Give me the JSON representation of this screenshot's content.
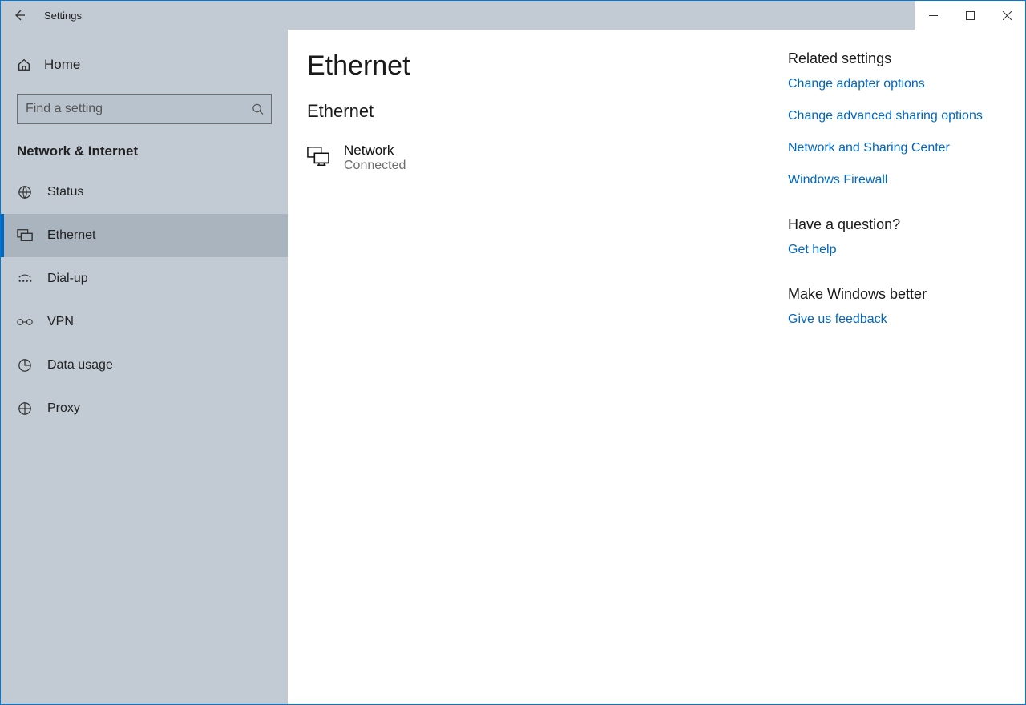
{
  "window": {
    "title": "Settings"
  },
  "sidebar": {
    "home": "Home",
    "search_placeholder": "Find a setting",
    "section": "Network & Internet",
    "items": [
      {
        "label": "Status"
      },
      {
        "label": "Ethernet"
      },
      {
        "label": "Dial-up"
      },
      {
        "label": "VPN"
      },
      {
        "label": "Data usage"
      },
      {
        "label": "Proxy"
      }
    ]
  },
  "main": {
    "title": "Ethernet",
    "section": "Ethernet",
    "network": {
      "name": "Network",
      "status": "Connected"
    }
  },
  "related": {
    "title": "Related settings",
    "links": [
      "Change adapter options",
      "Change advanced sharing options",
      "Network and Sharing Center",
      "Windows Firewall"
    ],
    "question_title": "Have a question?",
    "question_link": "Get help",
    "better_title": "Make Windows better",
    "better_link": "Give us feedback"
  }
}
